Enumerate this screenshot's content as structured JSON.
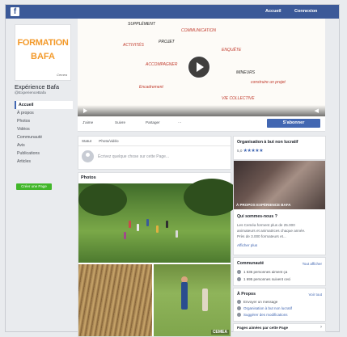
{
  "topbar": {
    "logo": "f",
    "link_home": "Accueil",
    "link_login": "Connexion"
  },
  "page": {
    "logo_line1": "FORMATION",
    "logo_line2": "BAFA",
    "logo_sig": "Cemea",
    "name": "Expérience Bafa",
    "handle": "@ExperienceBafa"
  },
  "nav": [
    "Accueil",
    "À propos",
    "Photos",
    "Vidéos",
    "Communauté",
    "Avis",
    "Publications",
    "Articles"
  ],
  "create_page": "Créer une Page",
  "cover_words": [
    "SUPPLÉMENT",
    "COMMUNICATION",
    "PROJET",
    "ENQUÊTE",
    "ACTIVITÉS",
    "ACCOMPAGNER",
    "MINEURS",
    "VIE COLLECTIVE",
    "construire un projet",
    "Encadrement"
  ],
  "action_bar": {
    "like": "J'aime",
    "follow": "Suivre",
    "share": "Partager",
    "more": "···",
    "subscribe": "S'abonner"
  },
  "composer": {
    "tab_status": "Statut",
    "tab_photo": "Photo/vidéo",
    "placeholder": "Écrivez quelque chose sur cette Page..."
  },
  "photos": {
    "title": "Photos",
    "see_all": "Voir tout",
    "watermark": "CEMEA"
  },
  "right": {
    "reply_title": "Organisation à but non lucratif",
    "rating": "5,0",
    "stars": "★★★★★",
    "about_caption": "À PROPOS EXPÉRIENCE BAFA",
    "who_title": "Qui sommes-nous ?",
    "who_text_1": "Les Ceméa forment plus de 25.000",
    "who_text_2": "animateurs et animatrices chaque année.",
    "who_text_3": "Près de 3.000 formateurs et...",
    "see_more": "Afficher plus",
    "community_title": "Communauté",
    "community_link": "Tout afficher",
    "community_row1": "1 636 personnes aiment ça",
    "community_row2": "1 695 personnes suivent ceci",
    "about_title": "À Propos",
    "about_link": "Voir tout",
    "about_row1": "Envoyer un message",
    "about_row2": "Organisation à but non lucratif",
    "about_row3": "Suggérer des modifications",
    "pages_title": "Pages aimées par cette Page"
  }
}
